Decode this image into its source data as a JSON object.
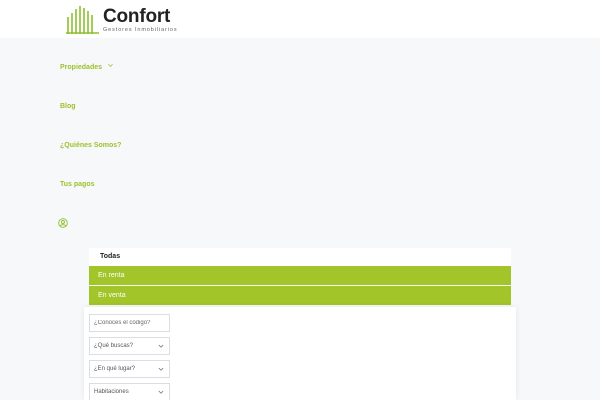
{
  "brand": {
    "name": "Confort",
    "tagline": "Gestores Inmobiliarios",
    "accent": "#9dc02c",
    "accent_fill": "#a2c52a"
  },
  "nav": {
    "items": [
      {
        "label": "Propiedades",
        "has_dropdown": true
      },
      {
        "label": "Blog"
      },
      {
        "label": "¿Quiénes Somos?"
      },
      {
        "label": "Tus pagos"
      }
    ],
    "user_icon": "user-circle-icon"
  },
  "filter": {
    "options": [
      "Todas",
      "En renta",
      "En venta"
    ],
    "selected": "Todas"
  },
  "search": {
    "code_placeholder": "¿Conoces el código?",
    "type_label": "¿Qué buscas?",
    "location_label": "¿En qué lugar?",
    "rooms_label": "Habitaciones"
  }
}
